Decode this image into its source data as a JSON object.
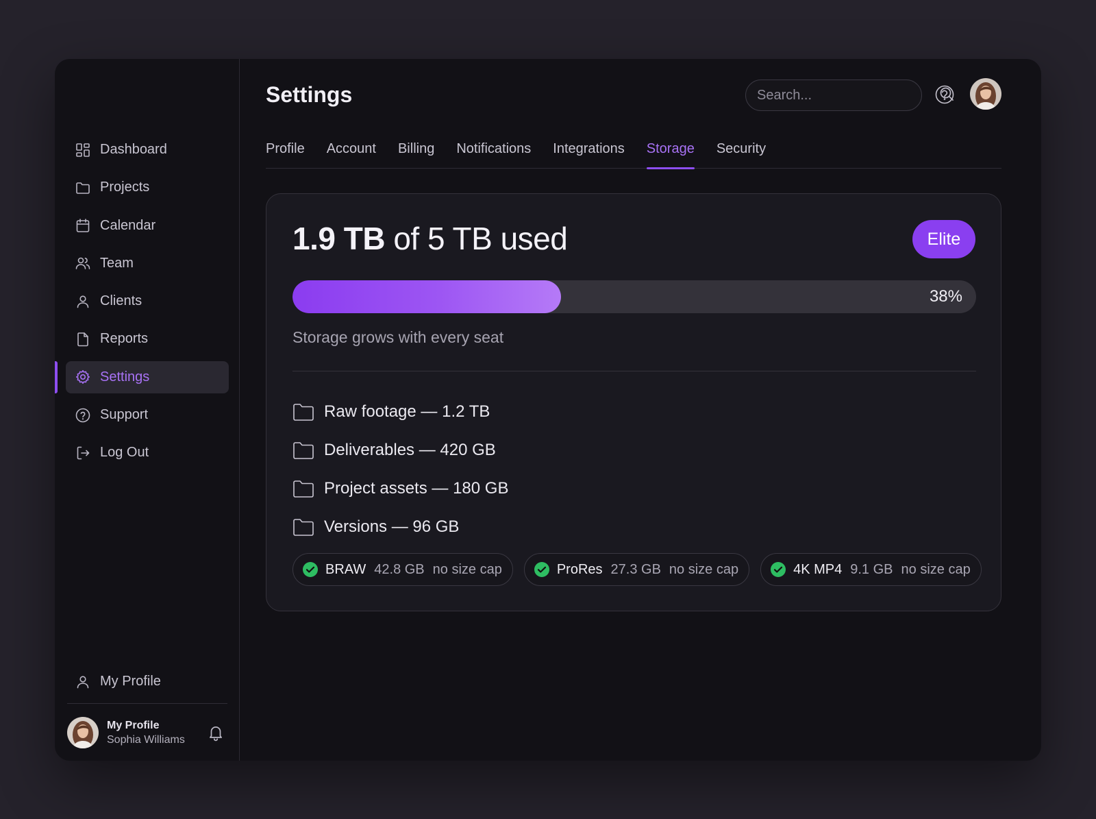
{
  "sidebar": {
    "items": [
      {
        "label": "Dashboard",
        "icon": "dashboard-icon"
      },
      {
        "label": "Projects",
        "icon": "folder-icon"
      },
      {
        "label": "Calendar",
        "icon": "calendar-icon"
      },
      {
        "label": "Team",
        "icon": "team-icon"
      },
      {
        "label": "Clients",
        "icon": "user-icon"
      },
      {
        "label": "Reports",
        "icon": "file-icon"
      },
      {
        "label": "Settings",
        "icon": "gear-icon",
        "active": true
      },
      {
        "label": "Support",
        "icon": "help-circle-icon"
      },
      {
        "label": "Log Out",
        "icon": "logout-icon"
      }
    ],
    "my_profile_label": "My Profile",
    "user": {
      "title": "My Profile",
      "name": "Sophia Williams"
    }
  },
  "header": {
    "title": "Settings",
    "search_placeholder": "Search..."
  },
  "tabs": [
    {
      "label": "Profile"
    },
    {
      "label": "Account"
    },
    {
      "label": "Billing"
    },
    {
      "label": "Notifications"
    },
    {
      "label": "Integrations"
    },
    {
      "label": "Storage",
      "active": true
    },
    {
      "label": "Security"
    }
  ],
  "storage": {
    "used": "1.9 TB",
    "of_total": "of 5 TB used",
    "plan": "Elite",
    "percent_label": "38%",
    "percent_value": 0.38,
    "note": "Storage grows with every seat",
    "folders": [
      {
        "label": "Raw footage — 1.2 TB"
      },
      {
        "label": "Deliverables — 420 GB"
      },
      {
        "label": "Project assets — 180 GB"
      },
      {
        "label": "Versions — 96 GB"
      }
    ],
    "formats": [
      {
        "name": "BRAW",
        "size": "42.8 GB",
        "cap": "no size cap"
      },
      {
        "name": "ProRes",
        "size": "27.3 GB",
        "cap": "no size cap"
      },
      {
        "name": "4K MP4",
        "size": "9.1 GB",
        "cap": "no size cap"
      }
    ]
  },
  "colors": {
    "accent": "#8a3ff0",
    "accent_text": "#a872f5",
    "success": "#2ebd62",
    "background": "#121116"
  }
}
